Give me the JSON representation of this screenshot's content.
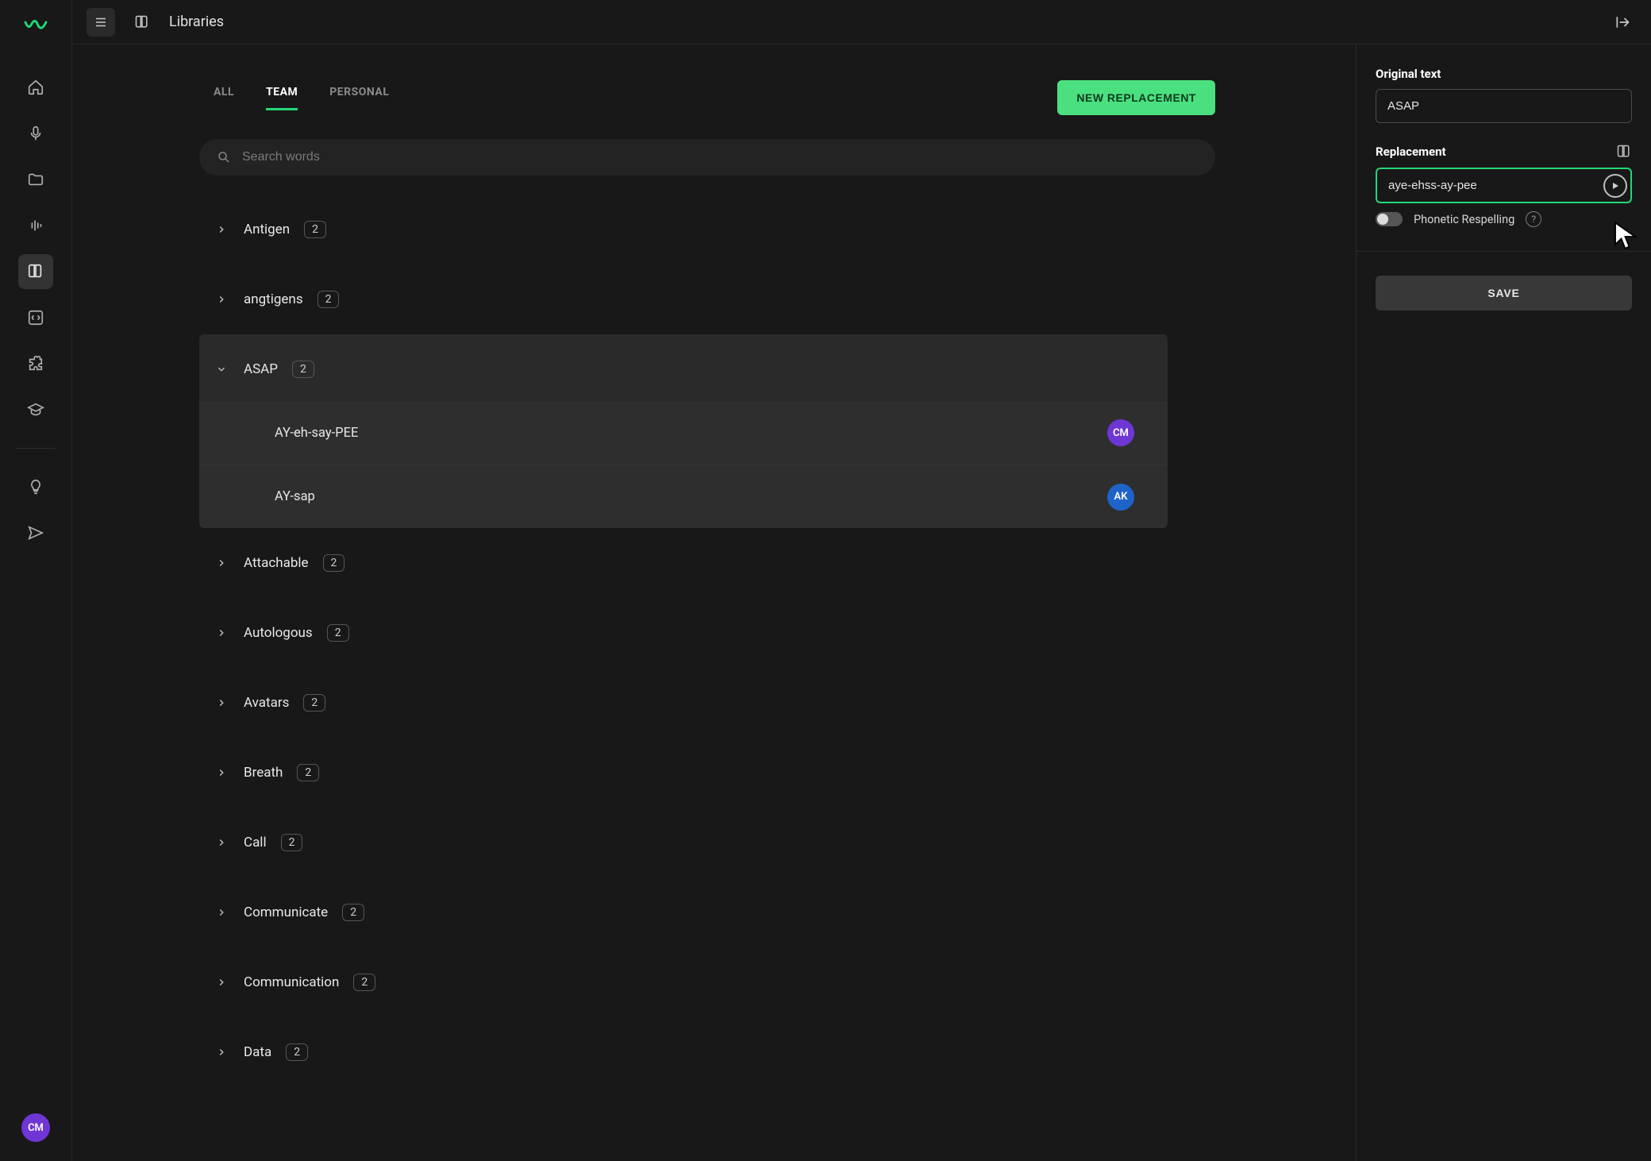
{
  "topbar": {
    "title": "Libraries"
  },
  "tabs": {
    "all": "ALL",
    "team": "TEAM",
    "personal": "PERSONAL",
    "active": "team"
  },
  "buttons": {
    "new_replacement": "NEW REPLACEMENT",
    "save": "SAVE"
  },
  "search": {
    "placeholder": "Search words"
  },
  "words": [
    {
      "label": "Antigen",
      "count": "2",
      "open": false
    },
    {
      "label": "angtigens",
      "count": "2",
      "open": false
    },
    {
      "label": "ASAP",
      "count": "2",
      "open": true,
      "subs": [
        {
          "label": "AY-eh-say-PEE",
          "chip": "CM",
          "chipClass": "cm"
        },
        {
          "label": "AY-sap",
          "chip": "AK",
          "chipClass": "ak"
        }
      ]
    },
    {
      "label": "Attachable",
      "count": "2",
      "open": false
    },
    {
      "label": "Autologous",
      "count": "2",
      "open": false
    },
    {
      "label": "Avatars",
      "count": "2",
      "open": false
    },
    {
      "label": "Breath",
      "count": "2",
      "open": false
    },
    {
      "label": "Call",
      "count": "2",
      "open": false
    },
    {
      "label": "Communicate",
      "count": "2",
      "open": false
    },
    {
      "label": "Communication",
      "count": "2",
      "open": false
    },
    {
      "label": "Data",
      "count": "2",
      "open": false
    }
  ],
  "panel": {
    "original_label": "Original text",
    "original_value": "ASAP",
    "replacement_label": "Replacement",
    "replacement_value": "aye-ehss-ay-pee",
    "phonetic_label": "Phonetic Respelling"
  },
  "user": {
    "initials": "CM"
  }
}
